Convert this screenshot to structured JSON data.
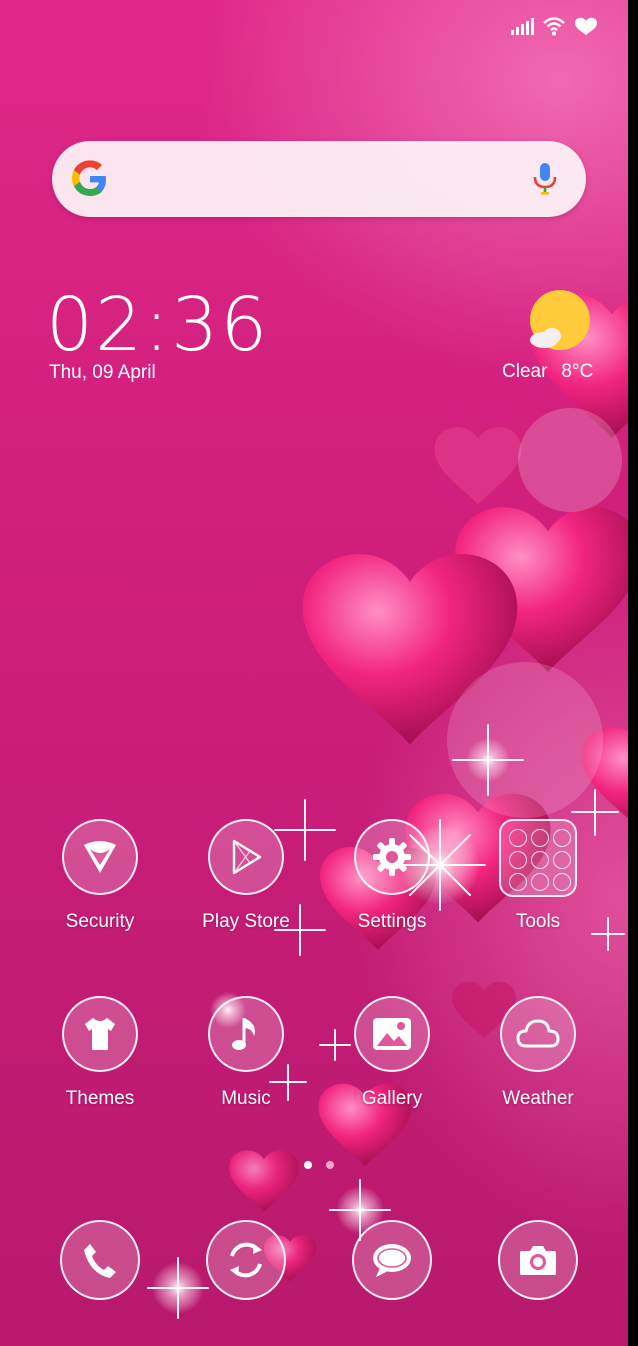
{
  "clock": {
    "hours": "02",
    "minutes": "36",
    "date": "Thu, 09 April"
  },
  "weather": {
    "condition": "Clear",
    "temperature": "8°C",
    "icon": "sun-cloud-icon"
  },
  "apps_row1": [
    {
      "label": "Security",
      "icon": "shield-icon"
    },
    {
      "label": "Play Store",
      "icon": "play-store-icon"
    },
    {
      "label": "Settings",
      "icon": "gear-icon"
    },
    {
      "label": "Tools",
      "icon": "tools-folder-icon"
    }
  ],
  "apps_row2": [
    {
      "label": "Themes",
      "icon": "tshirt-icon"
    },
    {
      "label": "Music",
      "icon": "music-note-icon"
    },
    {
      "label": "Gallery",
      "icon": "image-icon"
    },
    {
      "label": "Weather",
      "icon": "cloud-icon"
    }
  ],
  "dock": [
    {
      "icon": "phone-icon"
    },
    {
      "icon": "refresh-icon"
    },
    {
      "icon": "message-icon"
    },
    {
      "icon": "camera-icon"
    }
  ],
  "page_indicator": {
    "pages": 2,
    "current": 1
  },
  "colors": {
    "accent": "#d11f7c",
    "active_dot": "#ffffff",
    "inactive_dot": "#f0a6c8",
    "sun": "#ffcb3a"
  }
}
